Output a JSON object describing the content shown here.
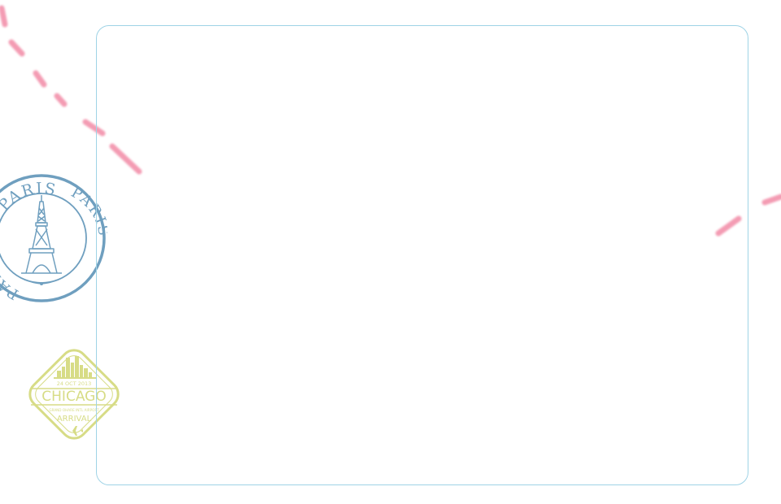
{
  "stamps": {
    "paris": {
      "text": "PARIS",
      "icon": "eiffel-tower-icon",
      "color": "#6f9fbf"
    },
    "chicago": {
      "date": "24 OCT 2013",
      "city": "CHICAGO",
      "subtext": "GRAND OHARE INTL AIRPORT",
      "status": "ARRIVAL",
      "icon": "airplane-icon",
      "color": "#d7dc86"
    }
  },
  "colors": {
    "frame_border": "#9fd3e6",
    "dashed_path": "#f07a9a",
    "background": "#ffffff"
  }
}
